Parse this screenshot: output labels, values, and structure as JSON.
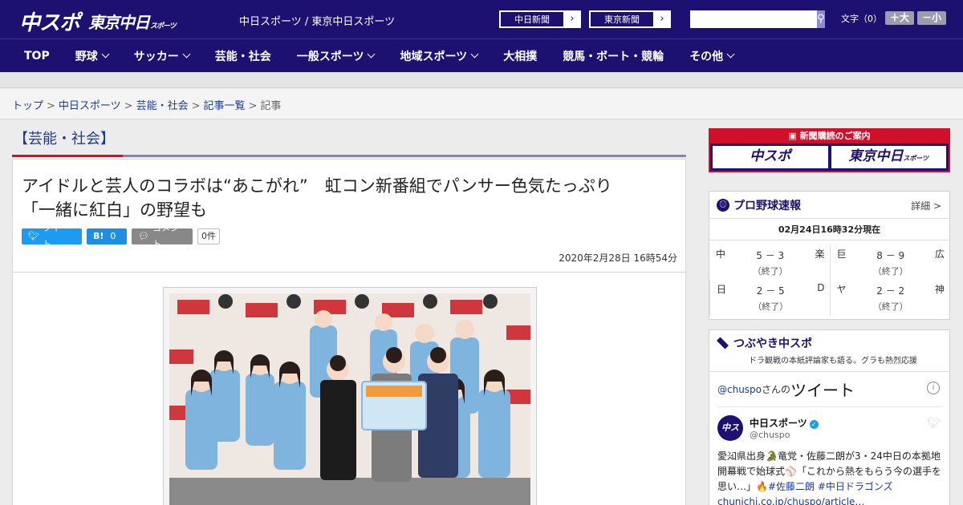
{
  "header": {
    "logo_primary": "中スポ",
    "logo_secondary": "東京中日",
    "logo_secondary_small": "スポーツ",
    "site_name": "中日スポーツ / 東京中日スポーツ",
    "ext_links": [
      {
        "label": "中日新聞"
      },
      {
        "label": "東京新聞"
      }
    ],
    "search_placeholder": "",
    "font_size_label": "文字（0）",
    "font_bigger": "＋大",
    "font_smaller": "－小"
  },
  "nav": [
    {
      "label": "TOP",
      "dropdown": false
    },
    {
      "label": "野球",
      "dropdown": true
    },
    {
      "label": "サッカー",
      "dropdown": true
    },
    {
      "label": "芸能・社会",
      "dropdown": false
    },
    {
      "label": "一般スポーツ",
      "dropdown": true
    },
    {
      "label": "地域スポーツ",
      "dropdown": true
    },
    {
      "label": "大相撲",
      "dropdown": false
    },
    {
      "label": "競馬・ボート・競輪",
      "dropdown": false
    },
    {
      "label": "その他",
      "dropdown": true
    }
  ],
  "breadcrumb": {
    "items": [
      "トップ",
      "中日スポーツ",
      "芸能・社会",
      "記事一覧"
    ],
    "current": "記事"
  },
  "article": {
    "category": "【芸能・社会】",
    "title_line1": "アイドルと芸人のコラボは“あこがれ”　虹コン新番組でパンサー色気たっぷり",
    "title_line2": "「一緒に紅白」の野望も",
    "tweet_label": "ツイート",
    "hatena_label": "B!",
    "hatena_count": "0",
    "comment_label": "コメント",
    "comment_count": "0件",
    "date": "2020年2月28日 16時54分"
  },
  "sidebar": {
    "subscribe_label": "新聞購読のご案内",
    "subscribe_logo1": "中スポ",
    "subscribe_logo2": "東京中日",
    "subscribe_logo2_small": "スポーツ",
    "baseball": {
      "title": "プロ野球速報",
      "more": "詳細 >",
      "as_of": "02月24日16時32分現在",
      "games": [
        {
          "home": "中",
          "score": "5 － 3",
          "status": "（終了）",
          "away": "楽"
        },
        {
          "home": "巨",
          "score": "8 － 9",
          "status": "（終了）",
          "away": "広"
        },
        {
          "home": "日",
          "score": "2 － 5",
          "status": "（終了）",
          "away": "D"
        },
        {
          "home": "ヤ",
          "score": "2 － 2",
          "status": "（終了）",
          "away": "神"
        }
      ]
    },
    "tsubuyaki": {
      "title": "つぶやき中スポ",
      "subtitle": "ドラ観戦の本紙評論家も語る。グラも熱烈応援",
      "timeline_handle": "@chuspo",
      "timeline_suffix": "さんの",
      "timeline_word": "ツイート",
      "user_name": "中日スポーツ",
      "user_handle": "@chuspo",
      "avatar_text": "中スポ",
      "tweet_text_1": "愛知県出身🐊竜党・佐藤二朗が3・24中日の本拠地開幕戦で始球式⚾「これから熱をもらう今の選手を思い…」🔥",
      "tweet_hashtags": "#佐藤二朗 #中日ドラゴンズ",
      "tweet_link": "chunichi.co.jp/chuspo/article…"
    }
  }
}
